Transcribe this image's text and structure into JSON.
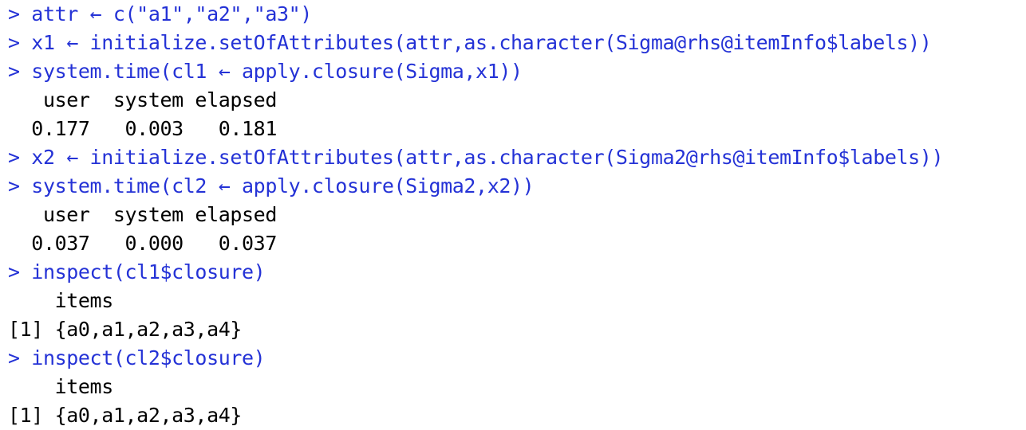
{
  "colors": {
    "input": "#2432d6",
    "output": "#000000",
    "background": "#ffffff"
  },
  "lines": [
    {
      "kind": "input",
      "text": "> attr ← c(\"a1\",\"a2\",\"a3\")"
    },
    {
      "kind": "input",
      "text": "> x1 ← initialize.setOfAttributes(attr,as.character(Sigma@rhs@itemInfo$labels))"
    },
    {
      "kind": "input",
      "text": "> system.time(cl1 ← apply.closure(Sigma,x1))"
    },
    {
      "kind": "output",
      "text": "   user  system elapsed"
    },
    {
      "kind": "output",
      "text": "  0.177   0.003   0.181"
    },
    {
      "kind": "input",
      "text": "> x2 ← initialize.setOfAttributes(attr,as.character(Sigma2@rhs@itemInfo$labels))"
    },
    {
      "kind": "input",
      "text": "> system.time(cl2 ← apply.closure(Sigma2,x2))"
    },
    {
      "kind": "output",
      "text": "   user  system elapsed"
    },
    {
      "kind": "output",
      "text": "  0.037   0.000   0.037"
    },
    {
      "kind": "input",
      "text": "> inspect(cl1$closure)"
    },
    {
      "kind": "output",
      "text": "    items"
    },
    {
      "kind": "output",
      "text": "[1] {a0,a1,a2,a3,a4}"
    },
    {
      "kind": "input",
      "text": "> inspect(cl2$closure)"
    },
    {
      "kind": "output",
      "text": "    items"
    },
    {
      "kind": "output",
      "text": "[1] {a0,a1,a2,a3,a4}"
    }
  ]
}
